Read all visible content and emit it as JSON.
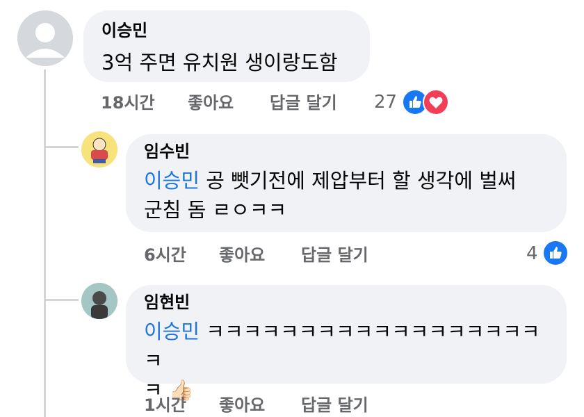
{
  "comments": [
    {
      "author": "이승민",
      "text": "3억 주면 유치원 생이랑도함",
      "time": "18시간",
      "like_label": "좋아요",
      "reply_label": "답글 달기",
      "reaction_count": "27",
      "reactions": [
        "like-icon",
        "love-icon"
      ]
    },
    {
      "author": "임수빈",
      "mention": "이승민",
      "text_line1": " 공 뺏기전에 제압부터 할 생각에 벌써",
      "text_line2": "군침 돔 ㄹㅇㅋㅋ",
      "time": "6시간",
      "like_label": "좋아요",
      "reply_label": "답글 달기",
      "reaction_count": "4",
      "reactions": [
        "like-icon"
      ]
    },
    {
      "author": "임현빈",
      "mention": "이승민",
      "text_line1": " ㅋㅋㅋㅋㅋㅋㅋㅋㅋㅋㅋㅋㅋㅋㅋㅋㅋㅋㅋ",
      "text_line2": "ㅋ",
      "emoji": "👍🏻",
      "time": "1시간",
      "like_label": "좋아요",
      "reply_label": "답글 달기"
    }
  ],
  "colors": {
    "like_blue": "#1877f2",
    "love_red": "#f33e58",
    "mention": "#1b74e4"
  }
}
